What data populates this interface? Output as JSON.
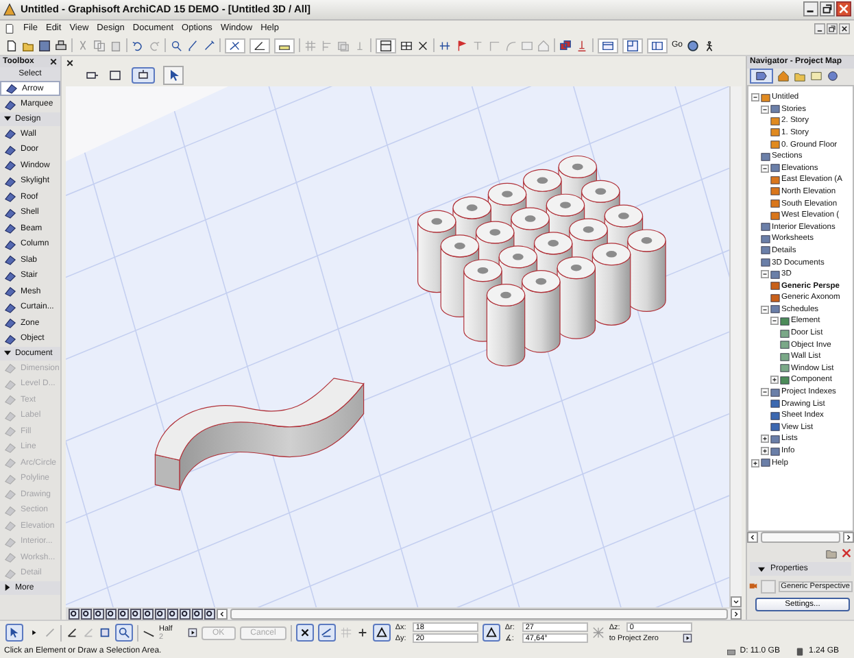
{
  "window": {
    "title": "Untitled - Graphisoft ArchiCAD 15 DEMO - [Untitled 3D / All]"
  },
  "menu": [
    "File",
    "Edit",
    "View",
    "Design",
    "Document",
    "Options",
    "Window",
    "Help"
  ],
  "toolbar": {
    "go_label": "Go"
  },
  "toolbox": {
    "title": "Toolbox",
    "groups": [
      {
        "label": "Select",
        "kind": "plain",
        "items": [
          {
            "label": "Arrow",
            "selected": true,
            "disabled": false
          },
          {
            "label": "Marquee",
            "selected": false,
            "disabled": false
          }
        ]
      },
      {
        "label": "Design",
        "kind": "expandable",
        "expanded": true,
        "items": [
          {
            "label": "Wall",
            "selected": false,
            "disabled": false
          },
          {
            "label": "Door",
            "selected": false,
            "disabled": false
          },
          {
            "label": "Window",
            "selected": false,
            "disabled": false
          },
          {
            "label": "Skylight",
            "selected": false,
            "disabled": false
          },
          {
            "label": "Roof",
            "selected": false,
            "disabled": false
          },
          {
            "label": "Shell",
            "selected": false,
            "disabled": false
          },
          {
            "label": "Beam",
            "selected": false,
            "disabled": false
          },
          {
            "label": "Column",
            "selected": false,
            "disabled": false
          },
          {
            "label": "Slab",
            "selected": false,
            "disabled": false
          },
          {
            "label": "Stair",
            "selected": false,
            "disabled": false
          },
          {
            "label": "Mesh",
            "selected": false,
            "disabled": false
          },
          {
            "label": "Curtain...",
            "selected": false,
            "disabled": false
          },
          {
            "label": "Zone",
            "selected": false,
            "disabled": false
          },
          {
            "label": "Object",
            "selected": false,
            "disabled": false
          }
        ]
      },
      {
        "label": "Document",
        "kind": "expandable",
        "expanded": true,
        "items": [
          {
            "label": "Dimension",
            "selected": false,
            "disabled": true
          },
          {
            "label": "Level D...",
            "selected": false,
            "disabled": true
          },
          {
            "label": "Text",
            "selected": false,
            "disabled": true
          },
          {
            "label": "Label",
            "selected": false,
            "disabled": true
          },
          {
            "label": "Fill",
            "selected": false,
            "disabled": true
          },
          {
            "label": "Line",
            "selected": false,
            "disabled": true
          },
          {
            "label": "Arc/Circle",
            "selected": false,
            "disabled": true
          },
          {
            "label": "Polyline",
            "selected": false,
            "disabled": true
          },
          {
            "label": "Drawing",
            "selected": false,
            "disabled": true
          },
          {
            "label": "Section",
            "selected": false,
            "disabled": true
          },
          {
            "label": "Elevation",
            "selected": false,
            "disabled": true
          },
          {
            "label": "Interior...",
            "selected": false,
            "disabled": true
          },
          {
            "label": "Worksh...",
            "selected": false,
            "disabled": true
          },
          {
            "label": "Detail",
            "selected": false,
            "disabled": true
          }
        ]
      },
      {
        "label": "More",
        "kind": "expandable",
        "expanded": false
      }
    ]
  },
  "navigator": {
    "title": "Navigator - Project Map",
    "tree": [
      {
        "label": "Untitled",
        "kind": "project",
        "selected": false,
        "expanded": true,
        "children": [
          {
            "label": "Stories",
            "kind": "folder",
            "selected": false,
            "expanded": true,
            "children": [
              {
                "label": "2. Story",
                "kind": "story",
                "selected": false
              },
              {
                "label": "1. Story",
                "kind": "story",
                "selected": false
              },
              {
                "label": "0. Ground Floor",
                "kind": "story",
                "selected": false
              }
            ]
          },
          {
            "label": "Sections",
            "kind": "folder",
            "selected": false
          },
          {
            "label": "Elevations",
            "kind": "folder",
            "selected": false,
            "expanded": true,
            "children": [
              {
                "label": "East Elevation (A",
                "kind": "elevation",
                "selected": false
              },
              {
                "label": "North Elevation",
                "kind": "elevation",
                "selected": false
              },
              {
                "label": "South Elevation",
                "kind": "elevation",
                "selected": false
              },
              {
                "label": "West Elevation (",
                "kind": "elevation",
                "selected": false
              }
            ]
          },
          {
            "label": "Interior Elevations",
            "kind": "folder",
            "selected": false
          },
          {
            "label": "Worksheets",
            "kind": "folder",
            "selected": false
          },
          {
            "label": "Details",
            "kind": "folder",
            "selected": false
          },
          {
            "label": "3D Documents",
            "kind": "folder",
            "selected": false
          },
          {
            "label": "3D",
            "kind": "folder",
            "selected": false,
            "expanded": true,
            "children": [
              {
                "label": "Generic Perspe",
                "kind": "perspective",
                "selected": true
              },
              {
                "label": "Generic Axonom",
                "kind": "perspective",
                "selected": false
              }
            ]
          },
          {
            "label": "Schedules",
            "kind": "folder",
            "selected": false,
            "expanded": true,
            "children": [
              {
                "label": "Element",
                "kind": "schedule",
                "selected": false,
                "expanded": true,
                "children": [
                  {
                    "label": "Door List",
                    "kind": "list",
                    "selected": false
                  },
                  {
                    "label": "Object Inve",
                    "kind": "list",
                    "selected": false
                  },
                  {
                    "label": "Wall List",
                    "kind": "list",
                    "selected": false
                  },
                  {
                    "label": "Window List",
                    "kind": "list",
                    "selected": false
                  }
                ]
              },
              {
                "label": "Component",
                "kind": "schedule",
                "selected": false,
                "expanded": false
              }
            ]
          },
          {
            "label": "Project Indexes",
            "kind": "folder",
            "selected": false,
            "expanded": true,
            "children": [
              {
                "label": "Drawing List",
                "kind": "index",
                "selected": false
              },
              {
                "label": "Sheet Index",
                "kind": "index",
                "selected": false
              },
              {
                "label": "View List",
                "kind": "index",
                "selected": false
              }
            ]
          },
          {
            "label": "Lists",
            "kind": "folder",
            "selected": false,
            "expanded": false
          },
          {
            "label": "Info",
            "kind": "folder",
            "selected": false,
            "expanded": false
          }
        ]
      },
      {
        "label": "Help",
        "kind": "folder",
        "selected": false,
        "expanded": false
      }
    ]
  },
  "properties": {
    "title": "Properties",
    "expanded": true,
    "view_name": "Generic Perspective",
    "settings_button": "Settings..."
  },
  "info_box": {
    "line_type": "Half",
    "line_sub": "2",
    "buttons": [
      {
        "label": "OK",
        "disabled": true
      },
      {
        "label": "Cancel",
        "disabled": true
      }
    ],
    "fields": [
      {
        "label": "Δx:",
        "value": "18"
      },
      {
        "label": "Δy:",
        "value": "20"
      },
      {
        "label": "Δr:",
        "value": "27"
      },
      {
        "label": "∡:",
        "value": "47,64°"
      },
      {
        "label": "Δz:",
        "value": "0"
      }
    ],
    "reference": "to Project Zero"
  },
  "status_bar": {
    "message": "Click an Element or Draw a Selection Area.",
    "disk": "D: 11.0 GB",
    "memory": "1.24 GB"
  }
}
